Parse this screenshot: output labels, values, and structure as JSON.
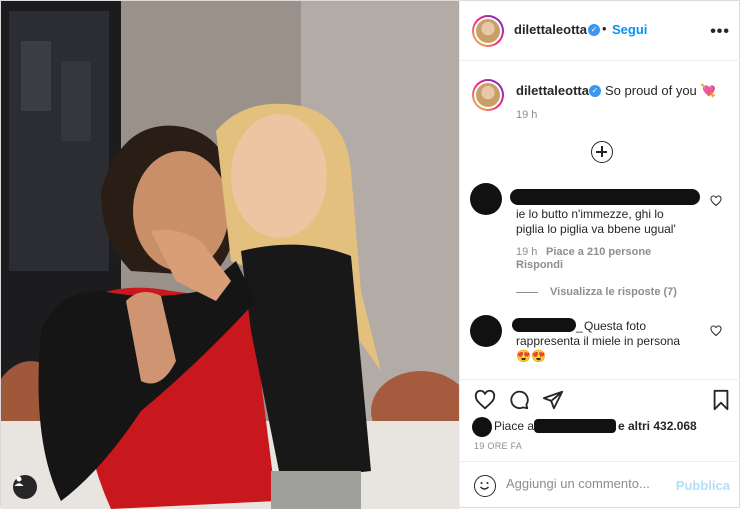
{
  "post": {
    "username": "dilettaleotta",
    "follow_label": "Segui",
    "more_label": "•••"
  },
  "caption": {
    "username": "dilettaleotta",
    "text": "So proud of you 💘",
    "time": "19 h"
  },
  "comments": [
    {
      "text_line1": "ie lo butto n'immezze, ghi lo",
      "text_line2": "piglia lo piglia va bbene ugual'",
      "time": "19 h",
      "likes": "Piace a 210 persone",
      "reply": "Rispondi",
      "view_replies": "Visualizza le risposte (7)"
    },
    {
      "username_suffix": "_",
      "text_line1": "Questa foto",
      "text_line2": "rappresenta il miele in persona",
      "text_line3": "😍😍"
    }
  ],
  "likes": {
    "prefix": "Piace a",
    "suffix": "e altri 432.068"
  },
  "timestamp": "19 ORE FA",
  "comment_box": {
    "placeholder": "Aggiungi un commento...",
    "publish_label": "Pubblica"
  },
  "colors": {
    "link_blue": "#0095f6",
    "verified_blue": "#3897f0",
    "publish_disabled": "#b2dffc",
    "muted": "#8e8e8e"
  },
  "icons": [
    "user-tag-icon",
    "verified-icon",
    "more-icon",
    "add-comment-circle-icon",
    "heart-icon",
    "comment-icon",
    "share-icon",
    "bookmark-icon",
    "emoji-icon"
  ]
}
